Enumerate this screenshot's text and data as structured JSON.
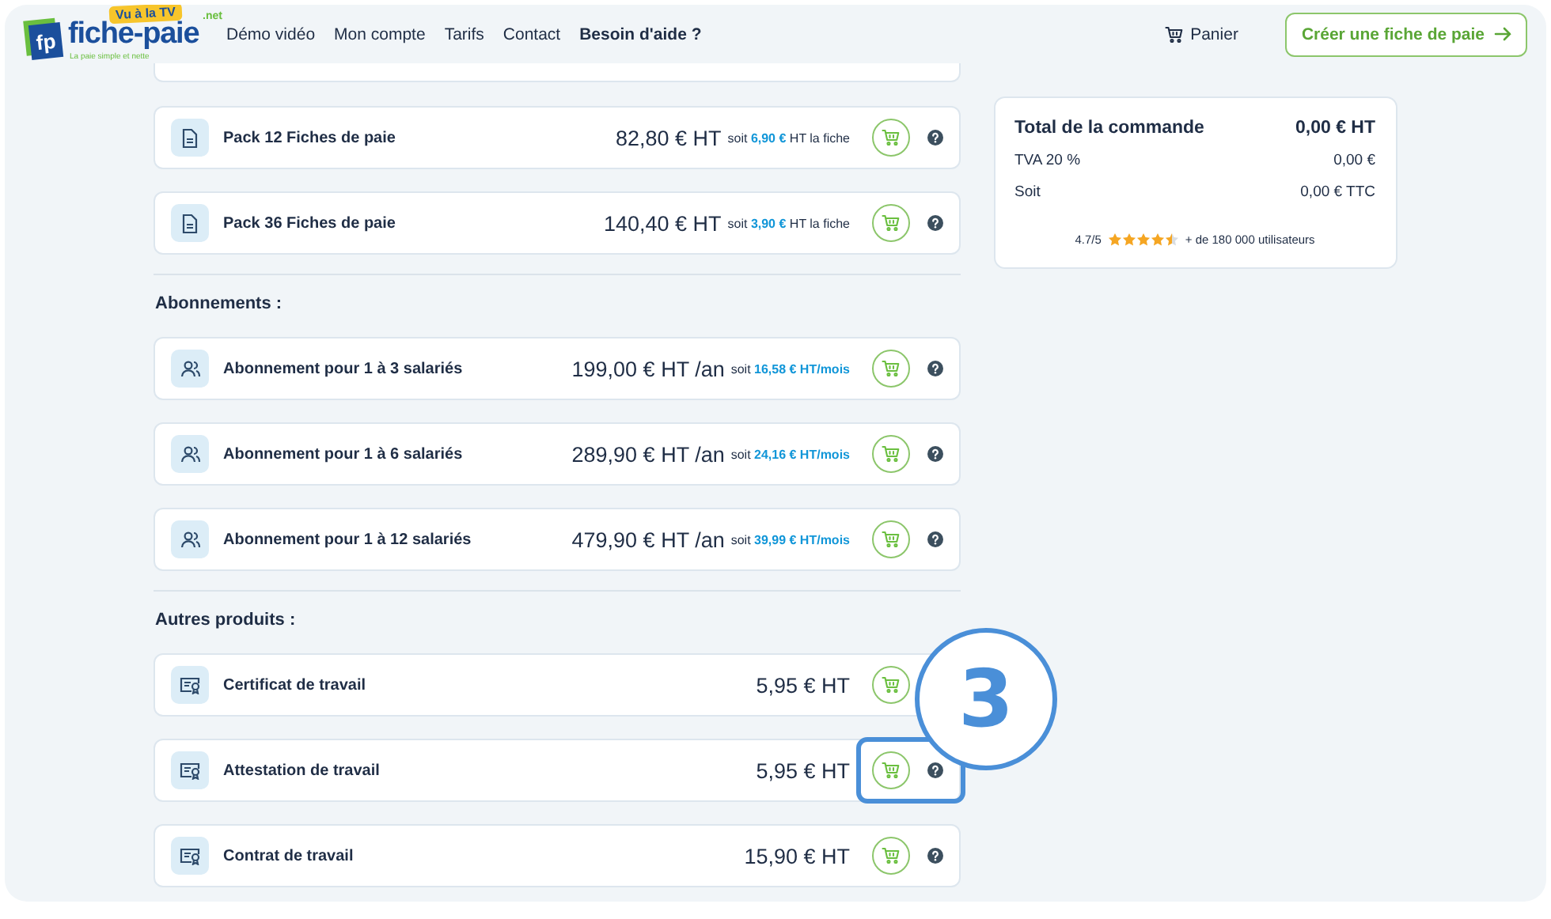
{
  "header": {
    "logo": {
      "monogram": "fp",
      "name": "fiche-paie",
      "tld": ".net",
      "badge": "Vu à la TV",
      "tagline": "La paie simple et nette"
    },
    "nav": [
      {
        "label": "Démo vidéo",
        "bold": false
      },
      {
        "label": "Mon compte",
        "bold": false
      },
      {
        "label": "Tarifs",
        "bold": false
      },
      {
        "label": "Contact",
        "bold": false
      },
      {
        "label": "Besoin d'aide ?",
        "bold": true
      }
    ],
    "cart": "Panier",
    "cta": "Créer une fiche de paie"
  },
  "sections": [
    {
      "continued_above": true,
      "products": [
        {
          "kind": "document",
          "name": "Pack 12 Fiches de paie",
          "price": "82,80 € HT",
          "detail": {
            "prefix": "soit",
            "highlight": "6,90 €",
            "rest": "HT la fiche"
          },
          "help": true,
          "highlighted": false
        },
        {
          "kind": "document",
          "name": "Pack 36 Fiches de paie",
          "price": "140,40 € HT",
          "detail": {
            "prefix": "soit",
            "highlight": "3,90 €",
            "rest": "HT la fiche"
          },
          "help": true,
          "highlighted": false
        }
      ]
    },
    {
      "title": "Abonnements :",
      "products": [
        {
          "kind": "people",
          "name": "Abonnement pour 1 à 3 salariés",
          "price": "199,00 € HT /an",
          "detail": {
            "prefix": "soit",
            "highlight": "16,58 € HT/mois"
          },
          "help": true,
          "highlighted": false
        },
        {
          "kind": "people",
          "name": "Abonnement pour 1 à 6 salariés",
          "price": "289,90 € HT /an",
          "detail": {
            "prefix": "soit",
            "highlight": "24,16 € HT/mois"
          },
          "help": true,
          "highlighted": false
        },
        {
          "kind": "people",
          "name": "Abonnement pour 1 à 12 salariés",
          "price": "479,90 € HT /an",
          "detail": {
            "prefix": "soit",
            "highlight": "39,99 € HT/mois"
          },
          "help": true,
          "highlighted": false
        }
      ]
    },
    {
      "title": "Autres produits :",
      "products": [
        {
          "kind": "certificate",
          "name": "Certificat de travail",
          "price": "5,95 € HT",
          "help": false,
          "highlighted": false
        },
        {
          "kind": "certificate",
          "name": "Attestation de travail",
          "price": "5,95 € HT",
          "help": true,
          "highlighted": true
        },
        {
          "kind": "certificate",
          "name": "Contrat de travail",
          "price": "15,90 € HT",
          "help": true,
          "highlighted": false
        }
      ]
    }
  ],
  "summary": {
    "title": "Total de la commande",
    "total": "0,00 € HT",
    "lines": [
      {
        "label": "TVA 20 %",
        "value": "0,00 €"
      },
      {
        "label": "Soit",
        "value": "0,00 € TTC"
      }
    ],
    "rating": "4.7/5",
    "stars": 4.5,
    "users": "+ de 180 000 utilisateurs"
  },
  "annotation": {
    "label": "3"
  }
}
